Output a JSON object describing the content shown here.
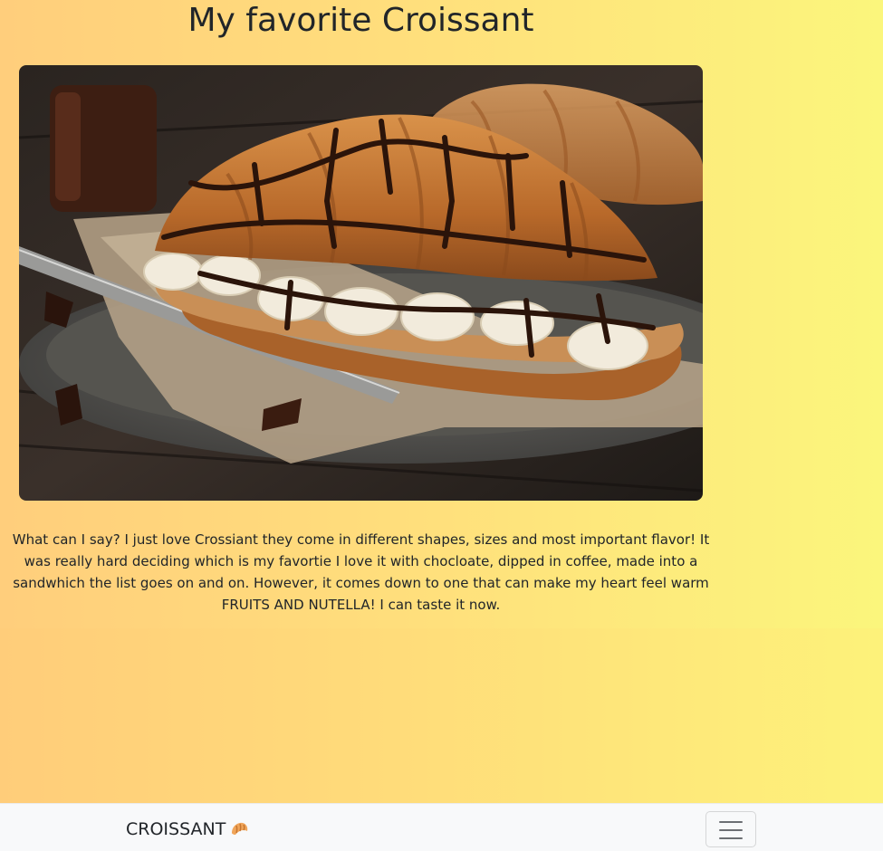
{
  "main": {
    "title": "My favorite Croissant",
    "image_alt": "croissant-with-banana-and-chocolate-photo",
    "description": "What can I say? I just love Crossiant they come in different shapes, sizes and most important flavor! It was really hard deciding which is my favortie I love it with chocloate, dipped in coffee, made into a sandwhich the list goes on and on. However, it comes down to one that can make my heart feel warm FRUITS AND NUTELLA! I can taste it now."
  },
  "navbar": {
    "brand": "CROISSANT",
    "brand_icon": "croissant-icon",
    "toggler_icon": "hamburger-menu-icon"
  },
  "colors": {
    "background_left": "#ffcd7a",
    "background_right": "#fdf27a",
    "navbar_bg": "#f8f9fa",
    "text": "#212529"
  }
}
